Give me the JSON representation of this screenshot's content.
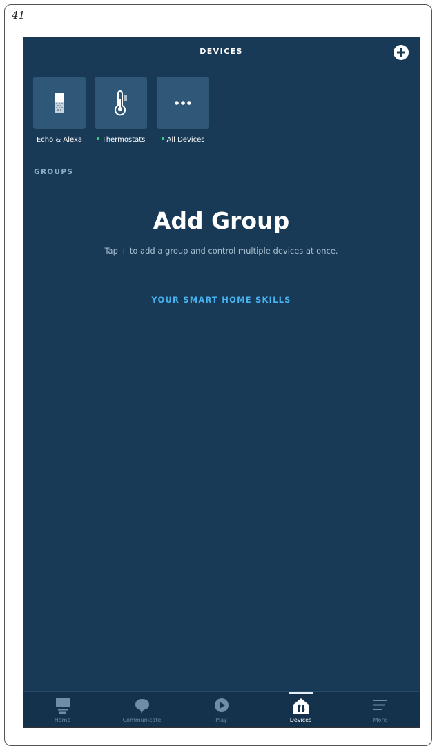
{
  "page_number": "41",
  "header": {
    "title": "DEVICES"
  },
  "device_tiles": [
    {
      "label": "Echo & Alexa",
      "icon": "echo-speaker-icon",
      "status_dot": false
    },
    {
      "label": "Thermostats",
      "icon": "thermometer-icon",
      "status_dot": true
    },
    {
      "label": "All Devices",
      "icon": "more-dots-icon",
      "status_dot": true
    }
  ],
  "groups": {
    "heading": "GROUPS",
    "empty_title": "Add Group",
    "empty_subtitle": "Tap + to add a group and control multiple devices at once."
  },
  "skills_link": "YOUR SMART HOME SKILLS",
  "bottom_nav": [
    {
      "label": "Home",
      "icon": "home-icon",
      "active": false
    },
    {
      "label": "Communicate",
      "icon": "chat-bubble-icon",
      "active": false
    },
    {
      "label": "Play",
      "icon": "play-icon",
      "active": false
    },
    {
      "label": "Devices",
      "icon": "devices-icon",
      "active": true
    },
    {
      "label": "More",
      "icon": "menu-lines-icon",
      "active": false
    }
  ],
  "colors": {
    "background": "#183a56",
    "tile": "#2f5878",
    "accent_link": "#47b3f0",
    "status_dot": "#35d07a"
  }
}
